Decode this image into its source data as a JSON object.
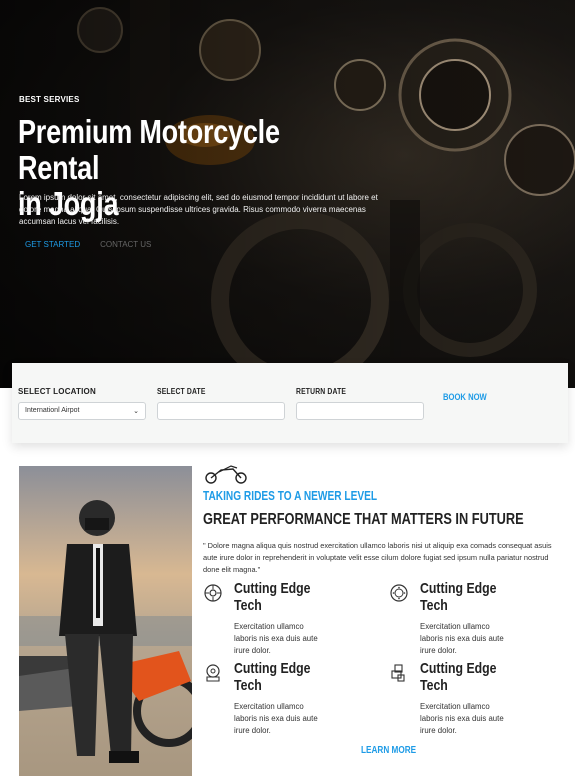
{
  "hero": {
    "eyebrow": "BEST SERVIES",
    "title_line1": "Premium Motorcycle Rental",
    "title_line2": "in Jogja",
    "description": "Lorem ipsum dolor sit amet, consectetur adipiscing elit, sed do eiusmod tempor incididunt ut labore et dolore magna aliqua. Quis ipsum suspendisse ultrices gravida. Risus commodo viverra maecenas accumsan lacus vel facilisis.",
    "primary_button": "GET STARTED",
    "secondary_button": "CONTACT US"
  },
  "booking": {
    "location_label": "SELECT LOCATION",
    "location_value": "Internationl Airpot",
    "date_label": "SELECT DATE",
    "date_value": "",
    "return_label": "RETURN DATE",
    "return_value": "",
    "submit_label": "BOOK NOW"
  },
  "about": {
    "icon": "motorcycle-icon",
    "tagline": "TAKING RIDES TO A NEWER LEVEL",
    "title": "GREAT PERFORMANCE THAT MATTERS IN FUTURE",
    "quote": "\" Dolore magna aliqua quis nostrud exercitation ullamco laboris nisi ut aliquip exa comads consequat asuis aute irure dolor in reprehenderit in voluptate velit esse cilum dolore fugiat sed ipsum nulla pariatur nostrud done elit magna.\"",
    "features": [
      {
        "icon": "engine-icon",
        "title": "Cutting Edge Tech",
        "text": "Exercitation ullamco laboris nis exa duis aute irure dolor."
      },
      {
        "icon": "brake-disc-icon",
        "title": "Cutting Edge Tech",
        "text": "Exercitation ullamco laboris nis exa duis aute irure dolor."
      },
      {
        "icon": "piston-icon",
        "title": "Cutting Edge Tech",
        "text": "Exercitation ullamco laboris nis exa duis aute irure dolor."
      },
      {
        "icon": "gearbox-icon",
        "title": "Cutting Edge Tech",
        "text": "Exercitation ullamco laboris nis exa duis aute irure dolor."
      }
    ],
    "learn_more": "LEARN MORE"
  },
  "colors": {
    "accent": "#1e9be6",
    "text_dark": "#222222",
    "booking_bg": "#f6f7f6"
  }
}
